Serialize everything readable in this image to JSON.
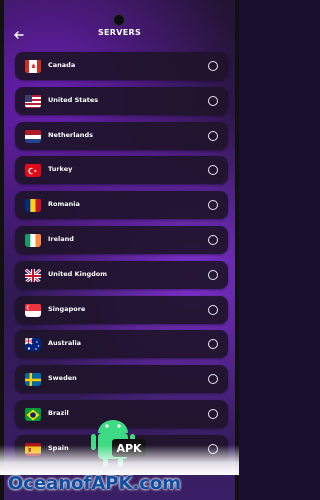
{
  "header": {
    "title": "SERVERS"
  },
  "servers": [
    {
      "name": "Canada",
      "flag": "canada-flag-icon"
    },
    {
      "name": "United States",
      "flag": "united-states-flag-icon"
    },
    {
      "name": "Netherlands",
      "flag": "netherlands-flag-icon"
    },
    {
      "name": "Turkey",
      "flag": "turkey-flag-icon"
    },
    {
      "name": "Romania",
      "flag": "romania-flag-icon"
    },
    {
      "name": "Ireland",
      "flag": "ireland-flag-icon"
    },
    {
      "name": "United Kingdom",
      "flag": "united-kingdom-flag-icon"
    },
    {
      "name": "Singapore",
      "flag": "singapore-flag-icon"
    },
    {
      "name": "Australia",
      "flag": "australia-flag-icon"
    },
    {
      "name": "Sweden",
      "flag": "sweden-flag-icon"
    },
    {
      "name": "Brazil",
      "flag": "brazil-flag-icon"
    },
    {
      "name": "Spain",
      "flag": "spain-flag-icon"
    }
  ],
  "watermark": {
    "text": "OceanofAPK.com"
  }
}
